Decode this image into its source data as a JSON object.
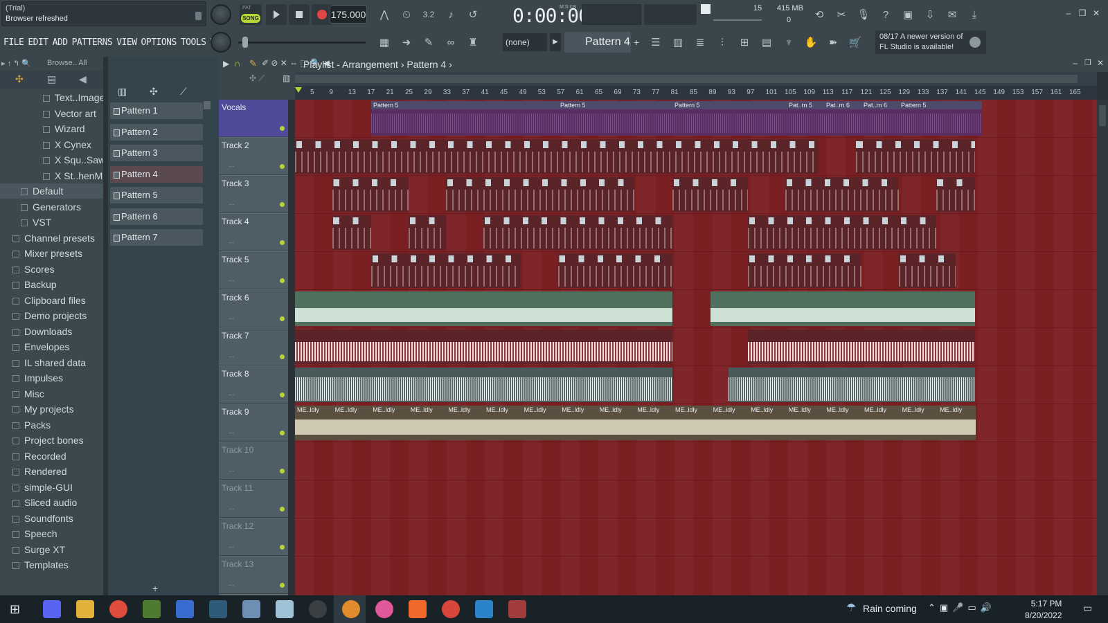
{
  "hint": {
    "line1": "(Trial)",
    "line2": "Browser refreshed"
  },
  "menu": [
    "FILE",
    "EDIT",
    "ADD",
    "PATTERNS",
    "VIEW",
    "OPTIONS",
    "TOOLS",
    "HELP"
  ],
  "transport": {
    "pat_label": "PAT",
    "song_label": "SONG",
    "tempo": "175.000",
    "time": "0:00:00",
    "time_mode": "M:S:CS"
  },
  "cpu": {
    "value1": "15",
    "memory": "415 MB",
    "value2": "0"
  },
  "toolbar": {
    "snap": "(none)",
    "pattern": "Pattern 4"
  },
  "update": {
    "date": "08/17",
    "line1": "A newer version of",
    "line2": "FL Studio is available!"
  },
  "browser": {
    "head": "Browse..  All",
    "items": [
      {
        "label": "Text..Image",
        "indent": 2
      },
      {
        "label": "Vector art",
        "indent": 2
      },
      {
        "label": "Wizard",
        "indent": 2
      },
      {
        "label": "X Cynex",
        "indent": 2
      },
      {
        "label": "X Squ..Saw",
        "indent": 2
      },
      {
        "label": "X St..henM",
        "indent": 2
      },
      {
        "label": "Default",
        "indent": 1
      },
      {
        "label": "Generators",
        "indent": 1
      },
      {
        "label": "VST",
        "indent": 1
      },
      {
        "label": "Channel presets",
        "indent": 0
      },
      {
        "label": "Mixer presets",
        "indent": 0
      },
      {
        "label": "Scores",
        "indent": 0
      },
      {
        "label": "Backup",
        "indent": 0
      },
      {
        "label": "Clipboard files",
        "indent": 0
      },
      {
        "label": "Demo projects",
        "indent": 0
      },
      {
        "label": "Downloads",
        "indent": 0
      },
      {
        "label": "Envelopes",
        "indent": 0
      },
      {
        "label": "IL shared data",
        "indent": 0
      },
      {
        "label": "Impulses",
        "indent": 0
      },
      {
        "label": "Misc",
        "indent": 0
      },
      {
        "label": "My projects",
        "indent": 0
      },
      {
        "label": "Packs",
        "indent": 0
      },
      {
        "label": "Project bones",
        "indent": 0
      },
      {
        "label": "Recorded",
        "indent": 0
      },
      {
        "label": "Rendered",
        "indent": 0
      },
      {
        "label": "simple-GUI",
        "indent": 0
      },
      {
        "label": "Sliced audio",
        "indent": 0
      },
      {
        "label": "Soundfonts",
        "indent": 0
      },
      {
        "label": "Speech",
        "indent": 0
      },
      {
        "label": "Surge XT",
        "indent": 0
      },
      {
        "label": "Templates",
        "indent": 0
      }
    ]
  },
  "patterns": [
    "Pattern 1",
    "Pattern 2",
    "Pattern 3",
    "Pattern 4",
    "Pattern 5",
    "Pattern 6",
    "Pattern 7"
  ],
  "selected_pattern": "Pattern 4",
  "playlist": {
    "title": "Playlist - Arrangement",
    "crumb": "Pattern 4"
  },
  "ruler": [
    "5",
    "9",
    "13",
    "17",
    "21",
    "25",
    "29",
    "33",
    "37",
    "41",
    "45",
    "49",
    "53",
    "57",
    "61",
    "65",
    "69",
    "73",
    "77",
    "81",
    "85",
    "89",
    "93",
    "97",
    "101",
    "105",
    "109",
    "113",
    "117",
    "121",
    "125",
    "129",
    "133",
    "137",
    "141",
    "145",
    "149",
    "153",
    "157",
    "161",
    "165"
  ],
  "tracks": [
    "Vocals",
    "Track 2",
    "Track 3",
    "Track 4",
    "Track 5",
    "Track 6",
    "Track 7",
    "Track 8",
    "Track 9",
    "Track 10",
    "Track 11",
    "Track 12",
    "Track 13"
  ],
  "clip_labels": {
    "vocals": [
      "Pattern 5",
      "Pattern 5",
      "Pattern 5",
      "Pat..rn 5",
      "Pat..rn 6",
      "Pat..rn 6",
      "Pattern 5"
    ],
    "track9": "ME..ldly"
  },
  "taskbar": {
    "weather": "Rain coming",
    "time": "5:17 PM",
    "date": "8/20/2022"
  }
}
